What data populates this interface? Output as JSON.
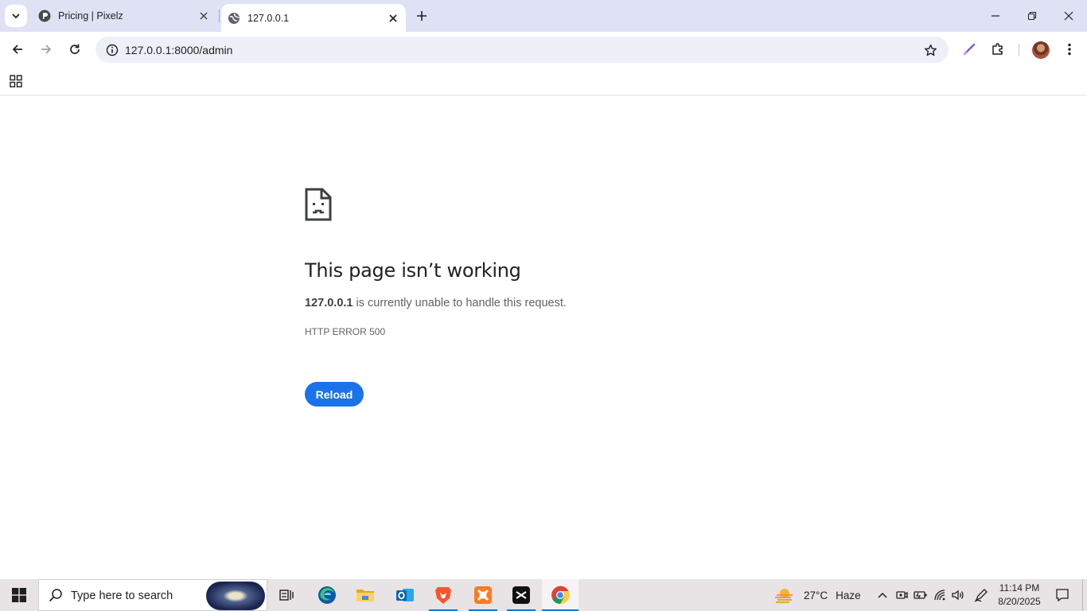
{
  "browser": {
    "tabs": [
      {
        "title": "Pricing | Pixelz",
        "active": false
      },
      {
        "title": "127.0.0.1",
        "active": true
      }
    ],
    "url": "127.0.0.1:8000/admin",
    "icons": {
      "tab_search": "chevron-down-icon",
      "new_tab": "plus-icon",
      "minimize": "minimize-icon",
      "restore": "restore-icon",
      "close": "close-icon",
      "back": "back-arrow-icon",
      "forward": "forward-arrow-icon",
      "reload": "reload-icon",
      "site_info": "info-icon",
      "bookmark": "star-icon",
      "extension_pen": "pen-icon",
      "extensions": "puzzle-icon",
      "menu": "kebab-menu-icon",
      "apps": "apps-grid-icon"
    }
  },
  "error_page": {
    "title": "This page isn’t working",
    "host": "127.0.0.1",
    "message": " is currently unable to handle this request.",
    "code": "HTTP ERROR 500",
    "reload_label": "Reload",
    "accent": "#1a73e8"
  },
  "taskbar": {
    "search_placeholder": "Type here to search",
    "weather": {
      "temp": "27°C",
      "condition": "Haze"
    },
    "clock": {
      "time": "11:14 PM",
      "date": "8/20/2025"
    },
    "apps": [
      "task-view",
      "edge",
      "file-explorer",
      "outlook",
      "brave",
      "xampp",
      "capcut",
      "chrome"
    ]
  }
}
